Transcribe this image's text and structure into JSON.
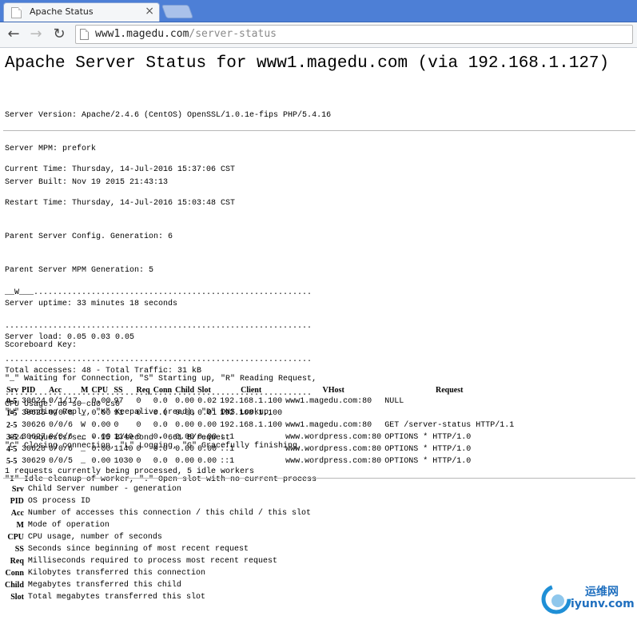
{
  "browser": {
    "tab_title": "Apache Status",
    "tab_close": "×",
    "url_host": "www1.magedu.com",
    "url_path": "/server-status"
  },
  "page": {
    "title": "Apache Server Status for www1.magedu.com (via 192.168.1.127)",
    "server_info": [
      "Server Version: Apache/2.4.6 (CentOS) OpenSSL/1.0.1e-fips PHP/5.4.16",
      "Server MPM: prefork",
      "Server Built: Nov 19 2015 21:43:13"
    ],
    "status_info": [
      "Current Time: Thursday, 14-Jul-2016 15:37:06 CST",
      "Restart Time: Thursday, 14-Jul-2016 15:03:48 CST",
      "Parent Server Config. Generation: 6",
      "Parent Server MPM Generation: 5",
      "Server uptime: 33 minutes 18 seconds",
      "Server load: 0.05 0.03 0.05",
      "Total accesses: 48 - Total Traffic: 31 kB",
      "CPU Usage: u0 s0 cu0 cs0",
      ".024 requests/sec - 15 B/second - 661 B/request",
      "1 requests currently being processed, 5 idle workers"
    ],
    "scoreboard": [
      "__W___..........................................................",
      "................................................................",
      "................................................................",
      "................................................................"
    ],
    "scoreboard_key": [
      "Scoreboard Key:",
      "\"_\" Waiting for Connection, \"S\" Starting up, \"R\" Reading Request,",
      "\"W\" Sending Reply, \"K\" Keepalive (read), \"D\" DNS Lookup,",
      "\"C\" Closing connection, \"L\" Logging, \"G\" Gracefully finishing,",
      "\"I\" Idle cleanup of worker, \".\" Open slot with no current process"
    ],
    "table_headers": [
      "Srv",
      "PID",
      "Acc",
      "M",
      "CPU",
      "SS",
      "Req",
      "Conn",
      "Child",
      "Slot",
      "Client",
      "VHost",
      "Request"
    ],
    "table_rows": [
      [
        "0-5",
        "30624",
        "0/1/17",
        "_",
        "0.00",
        "97",
        "0",
        "0.0",
        "0.00",
        "0.02",
        "192.168.1.100",
        "www1.magedu.com:80",
        "NULL"
      ],
      [
        "1-5",
        "30625",
        "0/0/8",
        "_",
        "0.00",
        "91",
        "0",
        "0.0",
        "0.00",
        "0.01",
        "192.168.1.100",
        "",
        ""
      ],
      [
        "2-5",
        "30626",
        "0/0/6",
        "W",
        "0.00",
        "0",
        "0",
        "0.0",
        "0.00",
        "0.00",
        "192.168.1.100",
        "www1.magedu.com:80",
        "GET /server-status HTTP/1.1"
      ],
      [
        "3-5",
        "30627",
        "0/0/6",
        "_",
        "0.00",
        "1140",
        "0",
        "0.0",
        "0.00",
        "0.00",
        "::1",
        "www.wordpress.com:80",
        "OPTIONS * HTTP/1.0"
      ],
      [
        "4-5",
        "30628",
        "0/0/6",
        "_",
        "0.00",
        "1140",
        "0",
        "0.0",
        "0.00",
        "0.00",
        "::1",
        "www.wordpress.com:80",
        "OPTIONS * HTTP/1.0"
      ],
      [
        "5-5",
        "30629",
        "0/0/5",
        "_",
        "0.00",
        "1030",
        "0",
        "0.0",
        "0.00",
        "0.00",
        "::1",
        "www.wordpress.com:80",
        "OPTIONS * HTTP/1.0"
      ]
    ],
    "legend": [
      {
        "key": "Srv",
        "desc": "Child Server number - generation"
      },
      {
        "key": "PID",
        "desc": "OS process ID"
      },
      {
        "key": "Acc",
        "desc": "Number of accesses this connection / this child / this slot"
      },
      {
        "key": "M",
        "desc": "Mode of operation"
      },
      {
        "key": "CPU",
        "desc": "CPU usage, number of seconds"
      },
      {
        "key": "SS",
        "desc": "Seconds since beginning of most recent request"
      },
      {
        "key": "Req",
        "desc": "Milliseconds required to process most recent request"
      },
      {
        "key": "Conn",
        "desc": "Kilobytes transferred this connection"
      },
      {
        "key": "Child",
        "desc": "Megabytes transferred this child"
      },
      {
        "key": "Slot",
        "desc": "Total megabytes transferred this slot"
      }
    ]
  },
  "watermark": {
    "cn": "运维网",
    "en": "iyunv.com"
  }
}
